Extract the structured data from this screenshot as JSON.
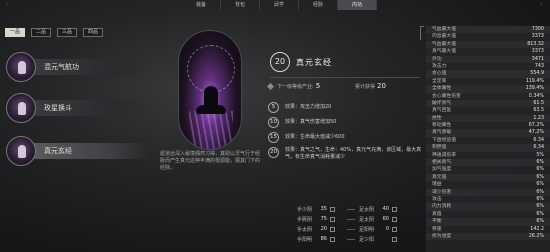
{
  "top_tabs": [
    "装备",
    "背包",
    "武学",
    "经脉",
    "内功"
  ],
  "top_tabs_active": 4,
  "sub_tabs": [
    "一品",
    "二品",
    "三品",
    "四品"
  ],
  "sub_tabs_active": 0,
  "skills": [
    {
      "name": "混元气航功"
    },
    {
      "name": "玫星换斗"
    },
    {
      "name": "真元玄经"
    }
  ],
  "skill_active": 2,
  "portrait_description": "超道远深入秘境偶然习得，其助以灵气行于经脉而产生真元这种丰满的根源能，展其门下的经脉。",
  "detail": {
    "level": "20",
    "title": "真元玄经",
    "next_level_label": "下一级等级产业:",
    "next_level_value": "5",
    "needed_label": "累计获得",
    "needed_value": "20",
    "effects": [
      {
        "lv": "5",
        "text": "效果：攻击力增加20"
      },
      {
        "lv": "10",
        "text": "效果：真气伤害增加50"
      },
      {
        "lv": "15",
        "text": "效果：生命最大值减少600"
      },
      {
        "lv": "20",
        "text": "效果：真气之气，生命：40%，真元气充满，该区域，最大真气，有生命真气消耗量减少"
      }
    ]
  },
  "meridians": [
    {
      "l1": "手少阴",
      "v1": "35",
      "l2": "足太阴",
      "v2": "40"
    },
    {
      "l1": "手厥阴",
      "v1": "75",
      "l2": "足太阴",
      "v2": "60"
    },
    {
      "l1": "手太阴",
      "v1": "20",
      "l2": "足阳明",
      "v2": "0"
    },
    {
      "l1": "手阳明",
      "v1": "86",
      "l2": "足少阳",
      "v2": ""
    }
  ],
  "stats": [
    {
      "k": "气血最大值",
      "v": "7300"
    },
    {
      "k": "内息最大值",
      "v": "3373"
    },
    {
      "k": "气血最大值",
      "v": "813.32"
    },
    {
      "k": "真气最大值",
      "v": "3373"
    },
    {
      "k": "外功",
      "v": "3471"
    },
    {
      "k": "攻击力",
      "v": "743"
    },
    {
      "k": "会心值",
      "v": "554.9"
    },
    {
      "k": "全定率",
      "v": "119.4%"
    },
    {
      "k": "全体属性",
      "v": "139.4%"
    },
    {
      "k": "会心属性伤害",
      "v": "0.34%"
    },
    {
      "k": "破坏真气",
      "v": "61.5"
    },
    {
      "k": "真气回复",
      "v": "63.5"
    },
    {
      "k": "抗性",
      "v": "1.23"
    },
    {
      "k": "移动属性",
      "v": "67.2%"
    },
    {
      "k": "真气承载",
      "v": "47.2%"
    },
    {
      "k": "下盘经验值",
      "v": "6.34"
    },
    {
      "k": "积攒值",
      "v": "6.34"
    },
    {
      "k": "神通减伤率",
      "v": "5%"
    },
    {
      "k": "相关真气",
      "v": "6%"
    },
    {
      "k": "加气强度",
      "v": "6%"
    },
    {
      "k": "真元值",
      "v": "6%"
    },
    {
      "k": "增益",
      "v": "6%"
    },
    {
      "k": "减少伤害",
      "v": "6%"
    },
    {
      "k": "攻击",
      "v": "6%"
    },
    {
      "k": "内力消耗",
      "v": "6%"
    },
    {
      "k": "真值",
      "v": "6%"
    },
    {
      "k": "平衡",
      "v": "6%"
    },
    {
      "k": "移速",
      "v": "142.2"
    },
    {
      "k": "修为进度",
      "v": "26.2%"
    }
  ]
}
